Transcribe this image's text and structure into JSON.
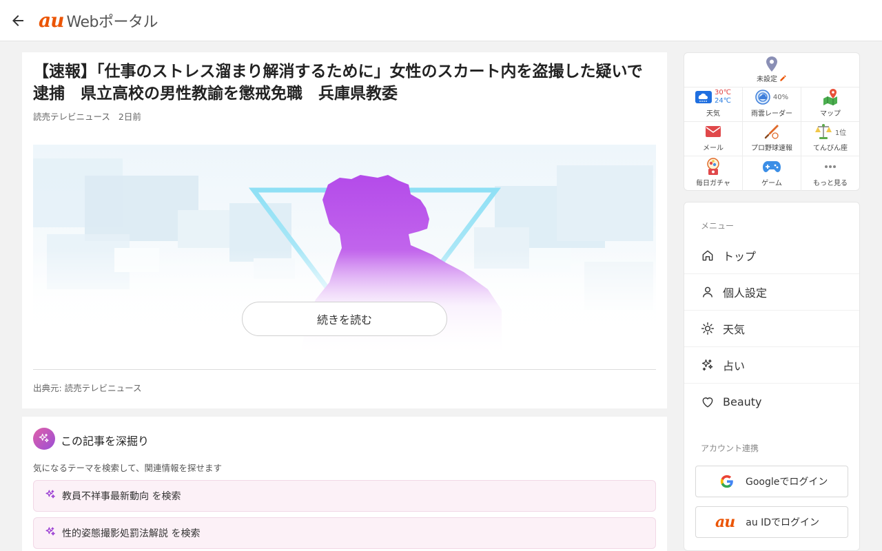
{
  "header": {
    "logo_brand": "au",
    "logo_text": "Webポータル"
  },
  "article": {
    "title": "【速報】「仕事のストレス溜まり解消するために」女性のスカート内を盗撮した疑いで逮捕　県立高校の男性教諭を懲戒免職　兵庫県教委",
    "publisher": "読売テレビニュース",
    "time_ago": "2日前",
    "read_more_label": "続きを読む",
    "source": "出典元: 読売テレビニュース"
  },
  "deep_dive": {
    "title": "この記事を深掘り",
    "description": "気になるテーマを検索して、関連情報を探せます",
    "searches": [
      {
        "label": "教員不祥事最新動向 を検索"
      },
      {
        "label": "性的姿態撮影処罰法解説 を検索"
      }
    ]
  },
  "widgets": {
    "location_label": "未設定",
    "weather": {
      "label": "天気",
      "high": "30℃",
      "low": "24℃"
    },
    "rain_radar": {
      "label": "雨雲レーダー",
      "value": "40%"
    },
    "map": {
      "label": "マップ"
    },
    "mail": {
      "label": "メール"
    },
    "baseball": {
      "label": "プロ野球速報"
    },
    "horoscope": {
      "label": "てんびん座",
      "value": "1位"
    },
    "gacha": {
      "label": "毎日ガチャ"
    },
    "game": {
      "label": "ゲーム"
    },
    "more": {
      "label": "もっと見る"
    }
  },
  "menu": {
    "heading": "メニュー",
    "items": [
      {
        "label": "トップ",
        "icon": "home-icon"
      },
      {
        "label": "個人設定",
        "icon": "person-icon"
      },
      {
        "label": "天気",
        "icon": "sun-icon"
      },
      {
        "label": "占い",
        "icon": "sparkle-icon"
      },
      {
        "label": "Beauty",
        "icon": "heart-icon"
      }
    ],
    "account_heading": "アカウント連携",
    "google_login": "Googleでログイン",
    "au_login": "au IDでログイン",
    "au_logo": "au"
  },
  "colors": {
    "brand_orange": "#eb5505",
    "accent_purple": "#b044e0",
    "chip_bg": "#fcf1f7"
  }
}
